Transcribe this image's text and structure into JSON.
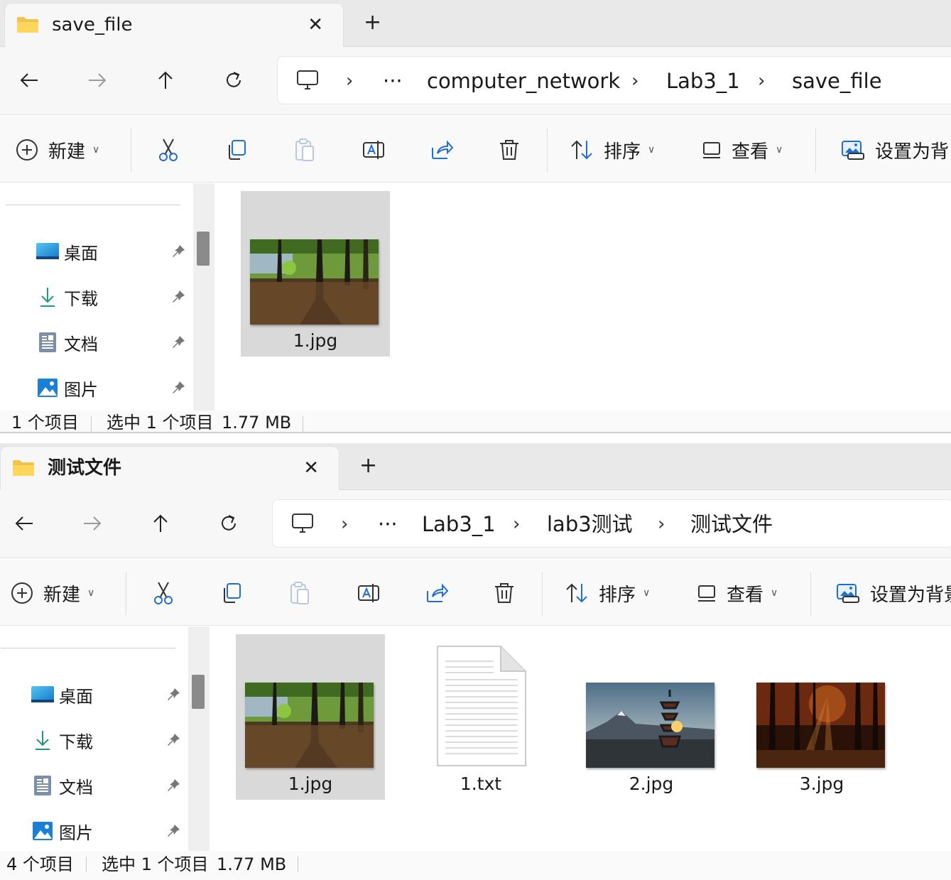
{
  "windows": [
    {
      "tab_title": "save_file",
      "path": [
        "computer_network",
        "Lab3_1",
        "save_file"
      ],
      "toolbar": {
        "new": "新建",
        "sort": "排序",
        "view": "查看",
        "set_bg": "设置为背"
      },
      "quick_access": [
        {
          "label": "桌面",
          "icon": "desktop-icon"
        },
        {
          "label": "下载",
          "icon": "download-icon"
        },
        {
          "label": "文档",
          "icon": "document-icon"
        },
        {
          "label": "图片",
          "icon": "pictures-icon"
        }
      ],
      "files": [
        {
          "name": "1.jpg",
          "kind": "forest",
          "selected": true
        }
      ],
      "status": {
        "count": "1 个项目",
        "selected": "选中 1 个项目",
        "size": "1.77 MB"
      }
    },
    {
      "tab_title": "测试文件",
      "path": [
        "Lab3_1",
        "lab3测试",
        "测试文件"
      ],
      "toolbar": {
        "new": "新建",
        "sort": "排序",
        "view": "查看",
        "set_bg": "设置为背景"
      },
      "quick_access": [
        {
          "label": "桌面",
          "icon": "desktop-icon"
        },
        {
          "label": "下载",
          "icon": "download-icon"
        },
        {
          "label": "文档",
          "icon": "document-icon"
        },
        {
          "label": "图片",
          "icon": "pictures-icon"
        }
      ],
      "files": [
        {
          "name": "1.jpg",
          "kind": "forest",
          "selected": true
        },
        {
          "name": "1.txt",
          "kind": "text",
          "selected": false
        },
        {
          "name": "2.jpg",
          "kind": "pagoda",
          "selected": false
        },
        {
          "name": "3.jpg",
          "kind": "autumn",
          "selected": false
        }
      ],
      "status": {
        "count": "4 个项目",
        "selected": "选中 1 个项目",
        "size": "1.77 MB"
      }
    }
  ],
  "ellipsis": "···",
  "new_tab": "+",
  "close": "✕"
}
